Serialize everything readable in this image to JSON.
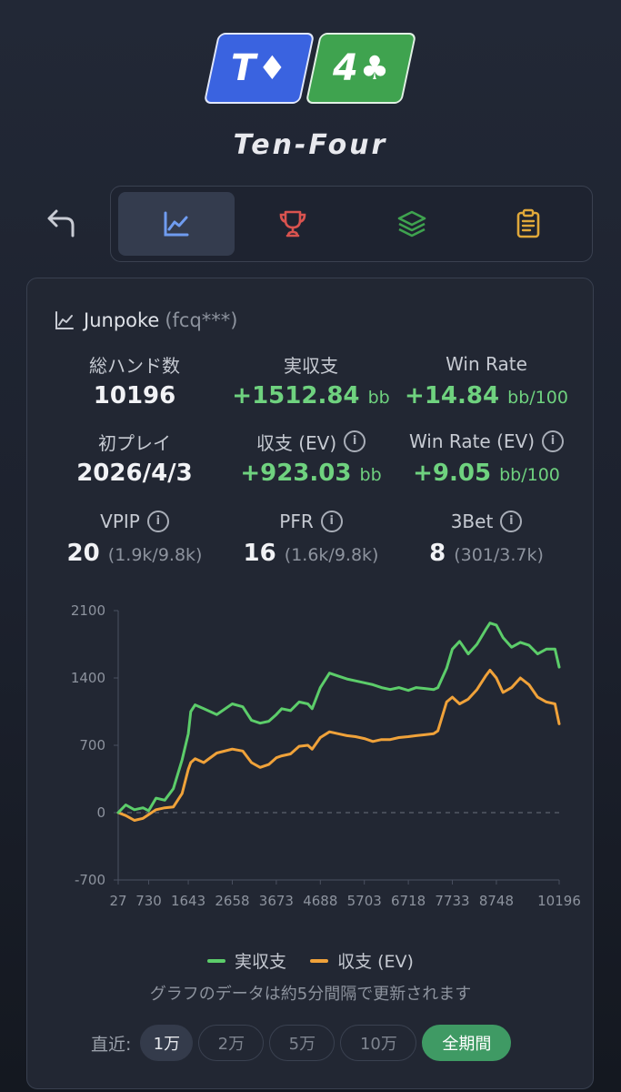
{
  "logo": {
    "card1_rank": "T",
    "card1_suit": "♦",
    "card2_rank": "4",
    "card2_suit": "♣",
    "card1_color": "#3a63e0",
    "card2_color": "#3fa34f"
  },
  "brand": "Ten-Four",
  "nav": {
    "back_icon": "back-arrow-icon",
    "tabs": [
      {
        "icon": "chart-icon",
        "active": true,
        "color": "#6f9cf0"
      },
      {
        "icon": "trophy-icon",
        "active": false,
        "color": "#d9534f"
      },
      {
        "icon": "layers-icon",
        "active": false,
        "color": "#3fa34f"
      },
      {
        "icon": "clipboard-icon",
        "active": false,
        "color": "#e0a83a"
      }
    ]
  },
  "player": {
    "name": "Junpoke",
    "id": "(fcq***)"
  },
  "stats": {
    "hands_label": "総ハンド数",
    "hands_value": "10196",
    "profit_label": "実収支",
    "profit_value": "+1512.84",
    "profit_unit": "bb",
    "winrate_label": "Win Rate",
    "winrate_value": "+14.84",
    "winrate_unit": "bb/100",
    "first_label": "初プレイ",
    "first_value": "2026/4/3",
    "ev_label": "収支 (EV)",
    "ev_value": "+923.03",
    "ev_unit": "bb",
    "evrate_label": "Win Rate (EV)",
    "evrate_value": "+9.05",
    "evrate_unit": "bb/100",
    "vpip_label": "VPIP",
    "vpip_value": "20",
    "vpip_detail": "(1.9k/9.8k)",
    "pfr_label": "PFR",
    "pfr_value": "16",
    "pfr_detail": "(1.6k/9.8k)",
    "threebet_label": "3Bet",
    "threebet_value": "8",
    "threebet_detail": "(301/3.7k)",
    "info_icon": "i"
  },
  "chart_data": {
    "type": "line",
    "x_ticks": [
      "27",
      "730",
      "1643",
      "2658",
      "3673",
      "4688",
      "5703",
      "6718",
      "7733",
      "8748",
      "10196"
    ],
    "y_ticks": [
      "2100",
      "1400",
      "700",
      "0",
      "-700"
    ],
    "ylim": [
      -700,
      2100
    ],
    "xlim": [
      27,
      10196
    ],
    "zero_line": "dashed",
    "series": [
      {
        "name": "実収支",
        "color": "#5ccd6a",
        "x": [
          27,
          200,
          400,
          600,
          730,
          900,
          1100,
          1300,
          1500,
          1643,
          1700,
          1800,
          2000,
          2300,
          2658,
          2900,
          3100,
          3300,
          3500,
          3673,
          3800,
          4000,
          4200,
          4400,
          4500,
          4688,
          4900,
          5100,
          5300,
          5500,
          5703,
          5900,
          6100,
          6300,
          6500,
          6718,
          6900,
          7100,
          7300,
          7400,
          7600,
          7733,
          7900,
          8100,
          8300,
          8500,
          8600,
          8748,
          8900,
          9100,
          9300,
          9500,
          9700,
          9900,
          10100,
          10196
        ],
        "y": [
          0,
          80,
          30,
          50,
          20,
          150,
          130,
          250,
          550,
          820,
          1050,
          1120,
          1080,
          1020,
          1130,
          1100,
          960,
          930,
          950,
          1020,
          1080,
          1060,
          1150,
          1130,
          1080,
          1300,
          1450,
          1420,
          1390,
          1370,
          1350,
          1330,
          1300,
          1280,
          1300,
          1270,
          1300,
          1290,
          1280,
          1300,
          1500,
          1700,
          1780,
          1650,
          1750,
          1900,
          1970,
          1950,
          1820,
          1720,
          1770,
          1740,
          1650,
          1700,
          1700,
          1512.84
        ]
      },
      {
        "name": "収支 (EV)",
        "color": "#f0a23a",
        "x": [
          27,
          200,
          400,
          600,
          730,
          900,
          1100,
          1300,
          1500,
          1643,
          1700,
          1800,
          2000,
          2300,
          2658,
          2900,
          3100,
          3300,
          3500,
          3673,
          3800,
          4000,
          4200,
          4400,
          4500,
          4688,
          4900,
          5100,
          5300,
          5500,
          5703,
          5900,
          6100,
          6300,
          6500,
          6718,
          6900,
          7100,
          7300,
          7400,
          7600,
          7733,
          7900,
          8100,
          8300,
          8500,
          8600,
          8748,
          8900,
          9100,
          9300,
          9500,
          9700,
          9900,
          10100,
          10196
        ],
        "y": [
          0,
          -30,
          -80,
          -60,
          -20,
          30,
          50,
          60,
          200,
          450,
          520,
          560,
          520,
          620,
          660,
          640,
          520,
          470,
          500,
          570,
          590,
          610,
          690,
          700,
          660,
          780,
          840,
          820,
          800,
          790,
          770,
          740,
          760,
          760,
          780,
          790,
          800,
          810,
          820,
          850,
          1150,
          1200,
          1130,
          1180,
          1280,
          1420,
          1480,
          1400,
          1250,
          1300,
          1400,
          1330,
          1200,
          1150,
          1130,
          923.03
        ]
      }
    ]
  },
  "legend": {
    "actual": "実収支",
    "ev": "収支 (EV)"
  },
  "note": "グラフのデータは約5分間隔で更新されます",
  "periods": {
    "label": "直近:",
    "options": [
      "1万",
      "2万",
      "5万",
      "10万",
      "全期間"
    ],
    "selected": "1万",
    "highlighted": "全期間"
  }
}
